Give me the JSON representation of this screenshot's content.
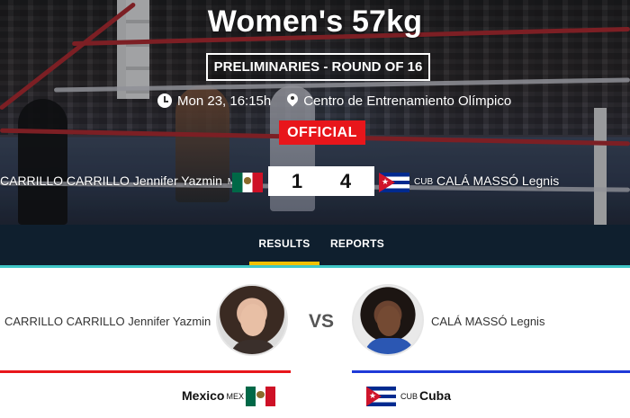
{
  "event": {
    "title": "Women's 57kg",
    "round": "PRELIMINARIES - ROUND OF 16",
    "datetime": "Mon 23, 16:15h",
    "venue": "Centro de Entrenamiento Olímpico",
    "status": "OFFICIAL"
  },
  "score": {
    "left_name": "CARRILLO CARRILLO Jennifer Yazmin",
    "left_code": "MEX",
    "left_score": "1",
    "right_code": "CUB",
    "right_name": "CALÁ MASSÓ Legnis",
    "right_score": "4"
  },
  "tabs": [
    {
      "label": "RESULTS",
      "active": true
    },
    {
      "label": "REPORTS",
      "active": false
    }
  ],
  "athletes": {
    "left": {
      "name": "CARRILLO CARRILLO Jennifer Yazmin",
      "country": "Mexico",
      "code": "MEX",
      "color": "#e8161b"
    },
    "right": {
      "name": "CALÁ MASSÓ Legnis",
      "country": "Cuba",
      "code": "CUB",
      "color": "#1f3ad8"
    },
    "vs_label": "VS"
  },
  "colors": {
    "official_red": "#e8161b",
    "tabbar_bg": "#0f1f2e",
    "active_tab_underline": "#f2c100",
    "divider_teal": "#3fc6c6"
  },
  "icons": [
    "clock-icon",
    "location-pin-icon",
    "mexico-flag-icon",
    "cuba-flag-icon"
  ]
}
